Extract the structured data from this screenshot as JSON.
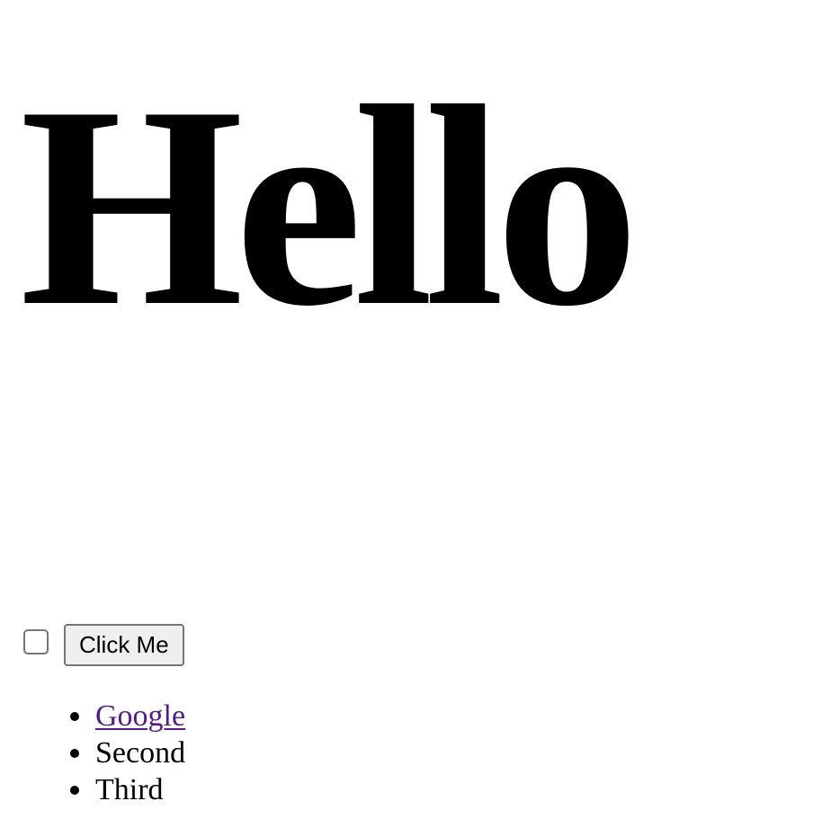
{
  "headline": {
    "text": "Hello"
  },
  "controls": {
    "checkbox_checked": false,
    "button_label": "Click Me"
  },
  "list": {
    "items": [
      {
        "label": "Google",
        "is_link": true
      },
      {
        "label": "Second",
        "is_link": false
      },
      {
        "label": "Third",
        "is_link": false
      }
    ]
  },
  "colors": {
    "link_visited": "#551a8b",
    "button_bg": "#efefef",
    "control_border": "#767676"
  }
}
